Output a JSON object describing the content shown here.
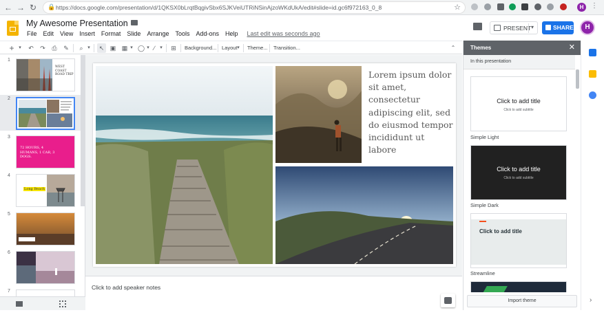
{
  "browser": {
    "url": "https://docs.google.com/presentation/d/1QKSX0bLrqtBqgivSbx6SJKVeiUTRiNSinAjzoWKdUkA/edit#slide=id.gc6f972163_0_8",
    "avatar_letter": "H"
  },
  "app": {
    "title": "My Awesome Presentation",
    "menu": [
      "File",
      "Edit",
      "View",
      "Insert",
      "Format",
      "Slide",
      "Arrange",
      "Tools",
      "Add-ons",
      "Help"
    ],
    "last_edit": "Last edit was seconds ago",
    "present_label": "PRESENT",
    "share_label": "SHARE",
    "avatar_letter": "H"
  },
  "toolbar": {
    "background_label": "Background...",
    "layout_label": "Layout",
    "theme_label": "Theme...",
    "transition_label": "Transition..."
  },
  "filmstrip": {
    "slide_numbers": [
      "1",
      "2",
      "3",
      "4",
      "5",
      "6",
      "7"
    ],
    "slide1_title": "WEST COAST ROAD TRIP",
    "slide3_text": "72 HOURS, 4 HUMANS, 1 CAR, 3 DOGS.",
    "slide4_title": "Long Beach"
  },
  "slide": {
    "body_text": "Lorem ipsum dolor sit amet, consectetur adipiscing elit, sed do eiusmod tempor incididunt ut labore"
  },
  "notes": {
    "placeholder": "Click to add speaker notes"
  },
  "themes": {
    "panel_title": "Themes",
    "section_label": "In this presentation",
    "cards": [
      {
        "name": "Simple Light",
        "title": "Click to add title",
        "subtitle": "Click to add subtitle"
      },
      {
        "name": "Simple Dark",
        "title": "Click to add title",
        "subtitle": "Click to add subtitle"
      },
      {
        "name": "Streamline",
        "title": "Click to add title",
        "subtitle": ""
      }
    ],
    "import_label": "Import theme"
  },
  "colors": {
    "accent": "#1a73e8",
    "selection": "#4285f4",
    "brand_yellow": "#f4b400",
    "pink": "#e91e8c"
  }
}
